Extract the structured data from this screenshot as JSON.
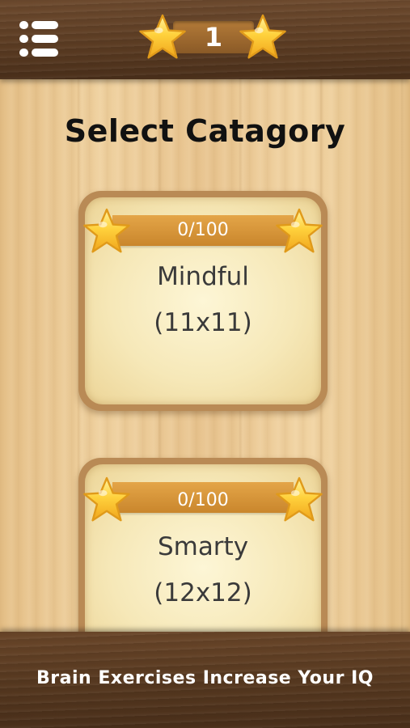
{
  "header": {
    "menu_icon": "menu-list-icon",
    "star_count": "1",
    "star_icon": "star-icon"
  },
  "title": "Select Catagory",
  "categories": [
    {
      "progress": "0/100",
      "name": "Mindful",
      "size": "(11x11)"
    },
    {
      "progress": "0/100",
      "name": "Smarty",
      "size": "(12x12)"
    }
  ],
  "footer": {
    "tagline": "Brain Exercises Increase Your IQ"
  },
  "colors": {
    "wood_dark": "#5a3b22",
    "wood_light": "#f0d2a0",
    "ribbon": "#d6953a",
    "star": "#ffc83a"
  }
}
